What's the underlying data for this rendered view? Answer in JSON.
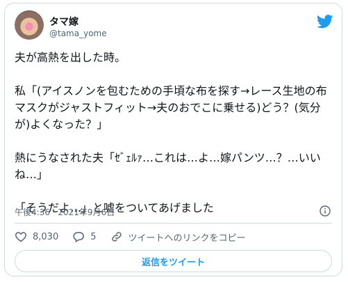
{
  "user": {
    "name": "タマ嫁",
    "handle": "@tama_yome"
  },
  "tweet": {
    "text": "夫が高熱を出した時。\n\n私「(アイスノンを包むための手頃な布を探す→レース生地の布マスクがジャストフィット→夫のおでこに乗せる)どう？(気分が)よくなった？」\n\n熱にうなされた夫「ｾﾞｪﾙｧ…これは…よ…嫁パンツ…？…いいね…」\n\n「そうだよ…」と嘘をついてあげました",
    "timestamp": "午後4:36 · 2021年9月6日"
  },
  "actions": {
    "like_count": "8,030",
    "reply_count": "5",
    "copy_link_label": "ツイートへのリンクをコピー"
  },
  "reply_button": "返信をツイート",
  "colors": {
    "accent": "#1d9bf0",
    "muted": "#536471",
    "text": "#0f1419",
    "border": "#cfd9de"
  }
}
